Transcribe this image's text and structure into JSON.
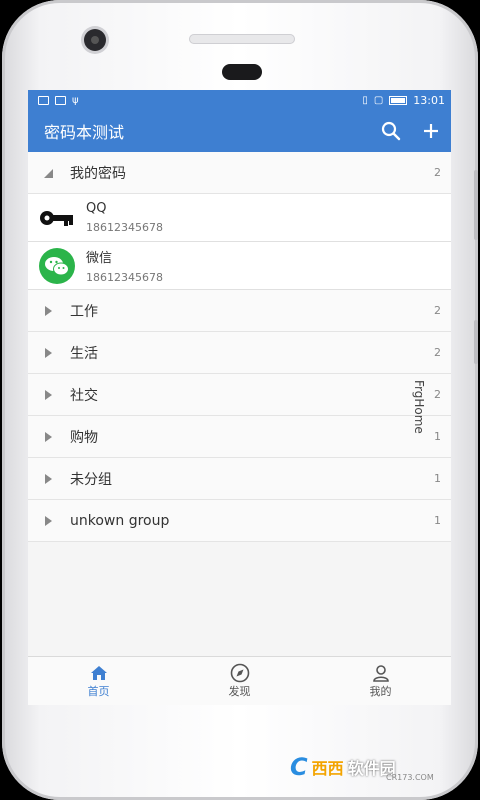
{
  "status_bar": {
    "time": "13:01"
  },
  "app_bar": {
    "title": "密码本测试",
    "search_icon": "search-icon",
    "add_icon": "plus-icon"
  },
  "groups": [
    {
      "name": "我的密码",
      "count": "2",
      "expanded": true
    },
    {
      "name": "工作",
      "count": "2"
    },
    {
      "name": "生活",
      "count": "2"
    },
    {
      "name": "社交",
      "count": "2"
    },
    {
      "name": "购物",
      "count": "1"
    },
    {
      "name": "未分组",
      "count": "1"
    },
    {
      "name": "unkown group",
      "count": "1"
    }
  ],
  "entries": [
    {
      "name": "QQ",
      "number": "18612345678",
      "icon": "key-icon"
    },
    {
      "name": "微信",
      "number": "18612345678",
      "icon": "wechat-icon"
    }
  ],
  "side_label": "FrgHome",
  "bottom_nav": [
    {
      "label": "首页",
      "icon": "home-icon",
      "active": true
    },
    {
      "label": "发现",
      "icon": "compass-icon"
    },
    {
      "label": "我的",
      "icon": "user-icon"
    }
  ],
  "watermark": {
    "logo": "C",
    "brand": "西西",
    "brand2": "软件园",
    "site": "CR173.COM"
  },
  "colors": {
    "primary": "#3e7fd1",
    "wechat_green": "#2bb44a"
  }
}
